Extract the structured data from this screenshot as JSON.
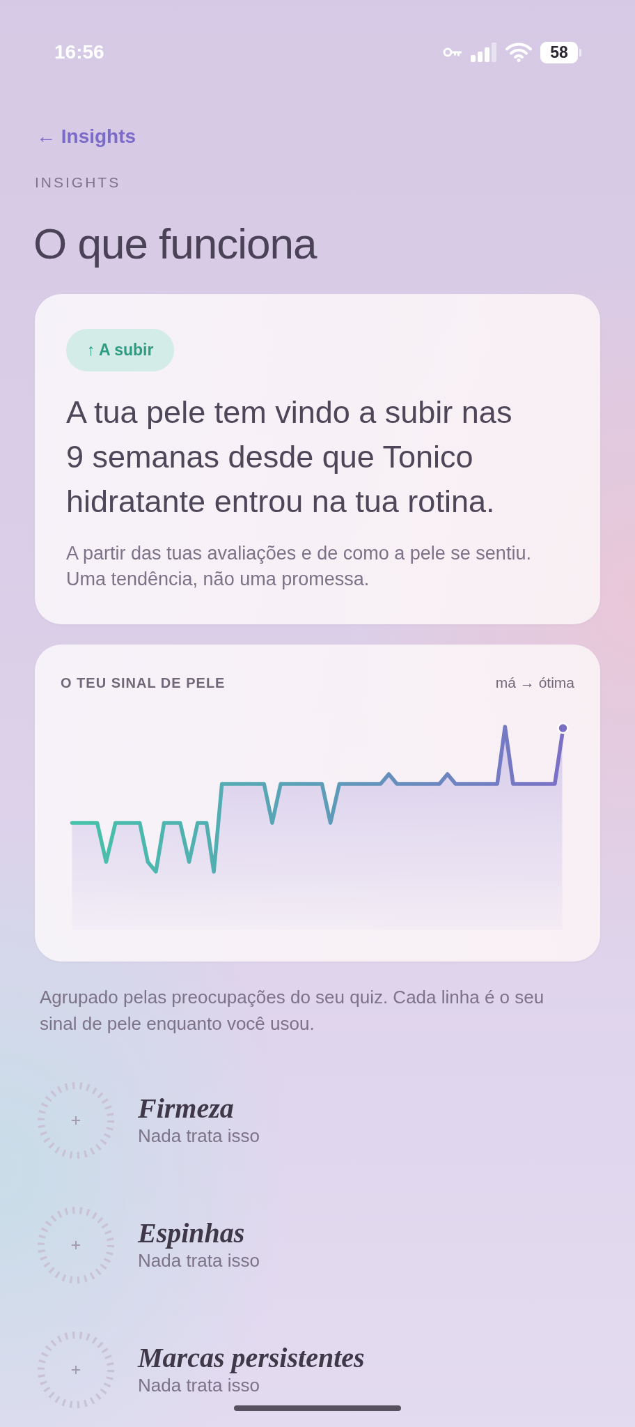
{
  "status_bar": {
    "time": "16:56",
    "battery": "58"
  },
  "back_link": "← Insights",
  "header": {
    "eyebrow": "INSIGHTS",
    "title": "O que funciona"
  },
  "summary_card": {
    "badge": "↑ A subir",
    "headline": "A tua pele tem vindo a subir nas 9 semanas desde que Tonico hidratante entrou na tua rotina.",
    "note": "A partir das tuas avaliações e de como a pele se sentiu. Uma tendência, não uma promessa."
  },
  "signal_card": {
    "title": "O TEU SINAL DE PELE",
    "scale_label": "má → ótima"
  },
  "caption": "Agrupado pelas preocupações do seu quiz. Cada linha é o seu sinal de pele enquanto você usou.",
  "concerns": [
    {
      "name": "Firmeza",
      "status": "Nada trata isso"
    },
    {
      "name": "Espinhas",
      "status": "Nada trata isso"
    },
    {
      "name": "Marcas persistentes",
      "status": "Nada trata isso"
    }
  ]
}
